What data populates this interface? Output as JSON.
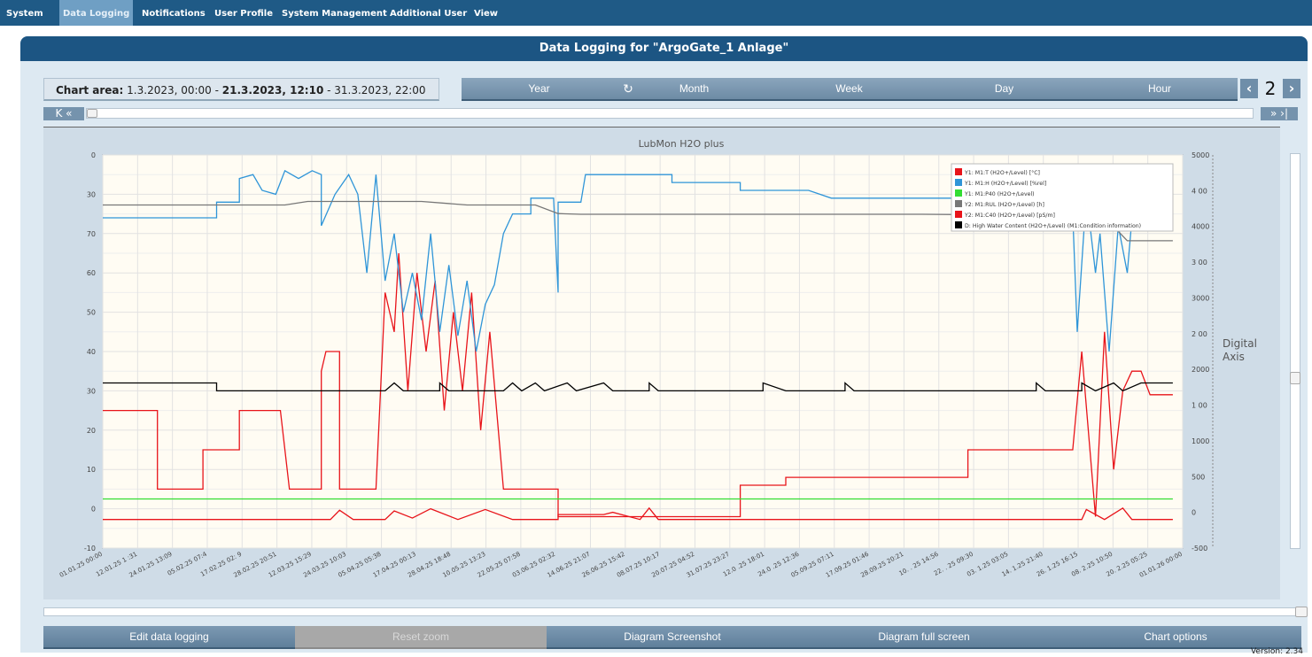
{
  "menu": {
    "items": [
      "System",
      "Data Logging",
      "Notifications",
      "User Profile",
      "System Management",
      "Additional User",
      "View"
    ],
    "active": "Data Logging"
  },
  "page_title": "Data Logging for \"ArgoGate_1 Anlage\"",
  "chart_area": {
    "label": "Chart area:",
    "start": "1.3.2023, 00:00",
    "sep1": " - ",
    "current": "21.3.2023, 12:10",
    "sep2": " - ",
    "end": "31.3.2023, 22:00"
  },
  "periods": [
    "Year",
    "Month",
    "Week",
    "Day",
    "Hour"
  ],
  "refresh_icon": "refresh-icon",
  "page_number": "2",
  "nav": {
    "prev": "<",
    "next": ">",
    "first": "K «",
    "last": "» ›|"
  },
  "bottom_buttons": {
    "edit": "Edit data logging",
    "reset_zoom": "Reset zoom",
    "screenshot": "Diagram Screenshot",
    "fullscreen": "Diagram full screen",
    "options": "Chart options"
  },
  "version": "Version: 2.34",
  "chart_data": {
    "type": "line",
    "title": "LubMon H2O plus",
    "digital_axis_label": [
      "Digital",
      "Axis"
    ],
    "y_left": {
      "ticks": [
        "0",
        "30",
        "70",
        "60",
        "50",
        "40",
        "30",
        "20",
        "10",
        "0",
        "-10"
      ],
      "range": [
        -10,
        90
      ]
    },
    "y_right": {
      "ticks": [
        "5000",
        "4 00",
        "4000",
        "3 00",
        "3000",
        "2 00",
        "2000",
        "1 00",
        "1000",
        "500",
        "0",
        "-500"
      ],
      "range": [
        -500,
        5000
      ]
    },
    "x_ticks": [
      "01.01.25 00:00",
      "12.01.25 1 :31",
      "24.01.25 13:09",
      "05.02.25 07:4",
      "17.02.25 02: 9",
      "28.02.25 20:51",
      "12.03.25 15:29",
      "24.03.25 10:03",
      "05.04.25 05:38",
      "17.04.25 00:13",
      "28.04.25 18:48",
      "10.05.25 13:23",
      "22.05.25 07:58",
      "03.06.25 02:32",
      "14.06.25 21:07",
      "26.06.25 15:42",
      "08.07.25 10:17",
      "20.07.25 04:52",
      "31.07.25 23:27",
      "12.0 .25 18:01",
      "24.0 .25 12:36",
      "05.09.25 07:11",
      "17.09.25 01:46",
      "28.09.25 20:21",
      "10. . 25 14:56",
      "22. . 25 09:30",
      "03. 1.25 03:05",
      "14. 1.25 21:40",
      "26. 1.25 16:15",
      "08. 2.25 10:50",
      "20. 2.25 05:25",
      "01.01.26 00:00"
    ],
    "legend_position": "top-right",
    "grid": true,
    "series": [
      {
        "name": "Y1: M1:T (H2O+/Level) [°C]",
        "color": "#e8141a",
        "points": [
          [
            0,
            25
          ],
          [
            12,
            25
          ],
          [
            12,
            5
          ],
          [
            22,
            5
          ],
          [
            22,
            15
          ],
          [
            30,
            15
          ],
          [
            30,
            25
          ],
          [
            39,
            25
          ],
          [
            41,
            5
          ],
          [
            48,
            5
          ],
          [
            48,
            35
          ],
          [
            49,
            40
          ],
          [
            52,
            40
          ],
          [
            52,
            5
          ],
          [
            60,
            5
          ],
          [
            62,
            55
          ],
          [
            64,
            45
          ],
          [
            65,
            65
          ],
          [
            67,
            30
          ],
          [
            69,
            60
          ],
          [
            71,
            40
          ],
          [
            73,
            58
          ],
          [
            75,
            25
          ],
          [
            77,
            50
          ],
          [
            79,
            30
          ],
          [
            81,
            55
          ],
          [
            83,
            20
          ],
          [
            85,
            45
          ],
          [
            88,
            5
          ],
          [
            100,
            5
          ],
          [
            100,
            -2
          ],
          [
            140,
            -2
          ],
          [
            140,
            6
          ],
          [
            150,
            6
          ],
          [
            150,
            8
          ],
          [
            183,
            8
          ],
          [
            190,
            8
          ],
          [
            190,
            15
          ],
          [
            213,
            15
          ],
          [
            215,
            40
          ],
          [
            218,
            -2
          ],
          [
            220,
            45
          ],
          [
            222,
            10
          ],
          [
            224,
            30
          ],
          [
            226,
            35
          ],
          [
            228,
            35
          ],
          [
            230,
            29
          ],
          [
            235,
            29
          ]
        ]
      },
      {
        "name": "Y1: M1:H (H2O+/Level) [%rel]",
        "color": "#2f95d8",
        "points": [
          [
            0,
            74
          ],
          [
            25,
            74
          ],
          [
            25,
            78
          ],
          [
            30,
            78
          ],
          [
            30,
            84
          ],
          [
            33,
            85
          ],
          [
            35,
            81
          ],
          [
            38,
            80
          ],
          [
            40,
            86
          ],
          [
            43,
            84
          ],
          [
            46,
            86
          ],
          [
            48,
            85
          ],
          [
            48,
            72
          ],
          [
            51,
            80
          ],
          [
            54,
            85
          ],
          [
            56,
            80
          ],
          [
            58,
            60
          ],
          [
            60,
            85
          ],
          [
            62,
            58
          ],
          [
            64,
            70
          ],
          [
            66,
            50
          ],
          [
            68,
            60
          ],
          [
            70,
            48
          ],
          [
            72,
            70
          ],
          [
            74,
            45
          ],
          [
            76,
            62
          ],
          [
            78,
            44
          ],
          [
            80,
            58
          ],
          [
            82,
            40
          ],
          [
            84,
            52
          ],
          [
            86,
            57
          ],
          [
            88,
            70
          ],
          [
            90,
            75
          ],
          [
            94,
            75
          ],
          [
            94,
            79
          ],
          [
            99,
            79
          ],
          [
            100,
            55
          ],
          [
            100,
            78
          ],
          [
            105,
            78
          ],
          [
            106,
            85
          ],
          [
            125,
            85
          ],
          [
            125,
            83
          ],
          [
            140,
            83
          ],
          [
            140,
            81
          ],
          [
            155,
            81
          ],
          [
            160,
            79
          ],
          [
            190,
            79
          ],
          [
            190,
            80
          ],
          [
            200,
            80
          ],
          [
            201,
            75
          ],
          [
            213,
            75
          ],
          [
            214,
            45
          ],
          [
            216,
            80
          ],
          [
            218,
            60
          ],
          [
            219,
            70
          ],
          [
            221,
            40
          ],
          [
            223,
            72
          ],
          [
            225,
            60
          ],
          [
            227,
            87
          ],
          [
            229,
            75
          ],
          [
            231,
            72
          ],
          [
            235,
            72
          ]
        ]
      },
      {
        "name": "Y1: M1:P40 (H2O+/Level)",
        "color": "#33dd33",
        "points": [
          [
            0,
            2.5
          ],
          [
            235,
            2.5
          ]
        ]
      },
      {
        "name": "Y2: M1:RUL (H2O+/Level) [h]",
        "color": "#777777",
        "points": [
          [
            0,
            4300
          ],
          [
            40,
            4300
          ],
          [
            45,
            4350
          ],
          [
            70,
            4350
          ],
          [
            80,
            4300
          ],
          [
            95,
            4300
          ],
          [
            100,
            4180
          ],
          [
            105,
            4170
          ],
          [
            140,
            4170
          ],
          [
            180,
            4170
          ],
          [
            200,
            4160
          ],
          [
            215,
            4160
          ],
          [
            220,
            4130
          ],
          [
            225,
            3800
          ],
          [
            235,
            3800
          ]
        ]
      },
      {
        "name": "Y2: M1:C40 (H2O+/Level) [pS/m]",
        "color": "#e8141a",
        "points": [
          [
            0,
            -100
          ],
          [
            50,
            -100
          ],
          [
            52,
            30
          ],
          [
            55,
            -100
          ],
          [
            62,
            -100
          ],
          [
            64,
            20
          ],
          [
            68,
            -80
          ],
          [
            72,
            50
          ],
          [
            78,
            -100
          ],
          [
            84,
            40
          ],
          [
            90,
            -100
          ],
          [
            100,
            -100
          ],
          [
            100,
            -30
          ],
          [
            110,
            -30
          ],
          [
            112,
            0
          ],
          [
            118,
            -100
          ],
          [
            120,
            60
          ],
          [
            122,
            -100
          ],
          [
            125,
            -100
          ],
          [
            150,
            -100
          ],
          [
            215,
            -100
          ],
          [
            216,
            40
          ],
          [
            220,
            -100
          ],
          [
            224,
            60
          ],
          [
            226,
            -100
          ],
          [
            235,
            -100
          ]
        ]
      },
      {
        "name": "D: High Water Content (H2O+/Level) (M1:Condition information)",
        "color": "#000000",
        "points": [
          [
            0,
            32
          ],
          [
            25,
            32
          ],
          [
            25,
            30
          ],
          [
            62,
            30
          ],
          [
            64,
            32
          ],
          [
            66,
            30
          ],
          [
            74,
            30
          ],
          [
            74,
            32
          ],
          [
            76,
            30
          ],
          [
            88,
            30
          ],
          [
            90,
            32
          ],
          [
            92,
            30
          ],
          [
            95,
            32
          ],
          [
            97,
            30
          ],
          [
            102,
            32
          ],
          [
            104,
            30
          ],
          [
            110,
            32
          ],
          [
            112,
            30
          ],
          [
            120,
            30
          ],
          [
            120,
            32
          ],
          [
            122,
            30
          ],
          [
            145,
            30
          ],
          [
            145,
            32
          ],
          [
            150,
            30
          ],
          [
            163,
            30
          ],
          [
            163,
            32
          ],
          [
            165,
            30
          ],
          [
            205,
            30
          ],
          [
            205,
            32
          ],
          [
            207,
            30
          ],
          [
            215,
            30
          ],
          [
            215,
            32
          ],
          [
            218,
            30
          ],
          [
            222,
            32
          ],
          [
            224,
            30
          ],
          [
            228,
            32
          ],
          [
            235,
            32
          ]
        ]
      }
    ]
  }
}
